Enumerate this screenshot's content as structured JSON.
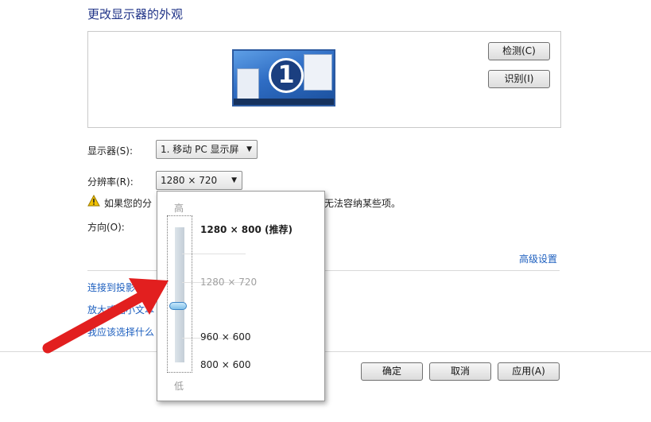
{
  "page": {
    "title": "更改显示器的外观"
  },
  "preview": {
    "monitor_number": "1"
  },
  "buttons": {
    "detect": "检测(C)",
    "identify": "识别(I)",
    "ok": "确定",
    "cancel": "取消",
    "apply": "应用(A)"
  },
  "display": {
    "label": "显示器(S):",
    "value": "1. 移动 PC 显示屏"
  },
  "resolution": {
    "label": "分辨率(R):",
    "value": "1280 × 720"
  },
  "warning": {
    "text_left": "如果您的分",
    "text_right": "无法容纳某些项。"
  },
  "orientation": {
    "label": "方向(O):"
  },
  "links": {
    "advanced": "高级设置",
    "projector": "连接到投影仪",
    "text_size": "放大或缩小文本",
    "help": "我应该选择什么"
  },
  "slider": {
    "high_label": "高",
    "low_label": "低",
    "selected_index": 1,
    "options": [
      {
        "label": "1280 × 800 (推荐)"
      },
      {
        "label": "1280 × 720"
      },
      {
        "label": "960 × 600"
      },
      {
        "label": "800 × 600"
      }
    ]
  },
  "colors": {
    "arrow": "#e21f1f",
    "link": "#1d5fbf",
    "title": "#1e3287"
  }
}
